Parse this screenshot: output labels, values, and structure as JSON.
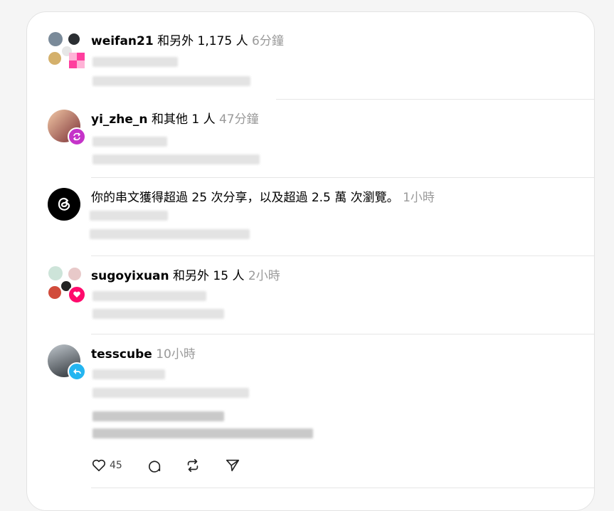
{
  "notifications": [
    {
      "user": "weifan21",
      "text": "和另外 1,175 人",
      "time": "6分鐘"
    },
    {
      "user": "yi_zhe_n",
      "text": "和其他 1 人",
      "time": "47分鐘"
    },
    {
      "user": "",
      "text": "你的串文獲得超過 25 次分享，以及超過 2.5 萬 次瀏覽。",
      "time": "1小時"
    },
    {
      "user": "sugoyixuan",
      "text": "和另外 15 人",
      "time": "2小時"
    },
    {
      "user": "tesscube",
      "text": "",
      "time": "10小時"
    }
  ],
  "actions": {
    "like_count": "45"
  },
  "colors": {
    "repost_badge": "#c533c9",
    "like_badge": "#ff0a6c",
    "reply_badge": "#24b5f0"
  }
}
